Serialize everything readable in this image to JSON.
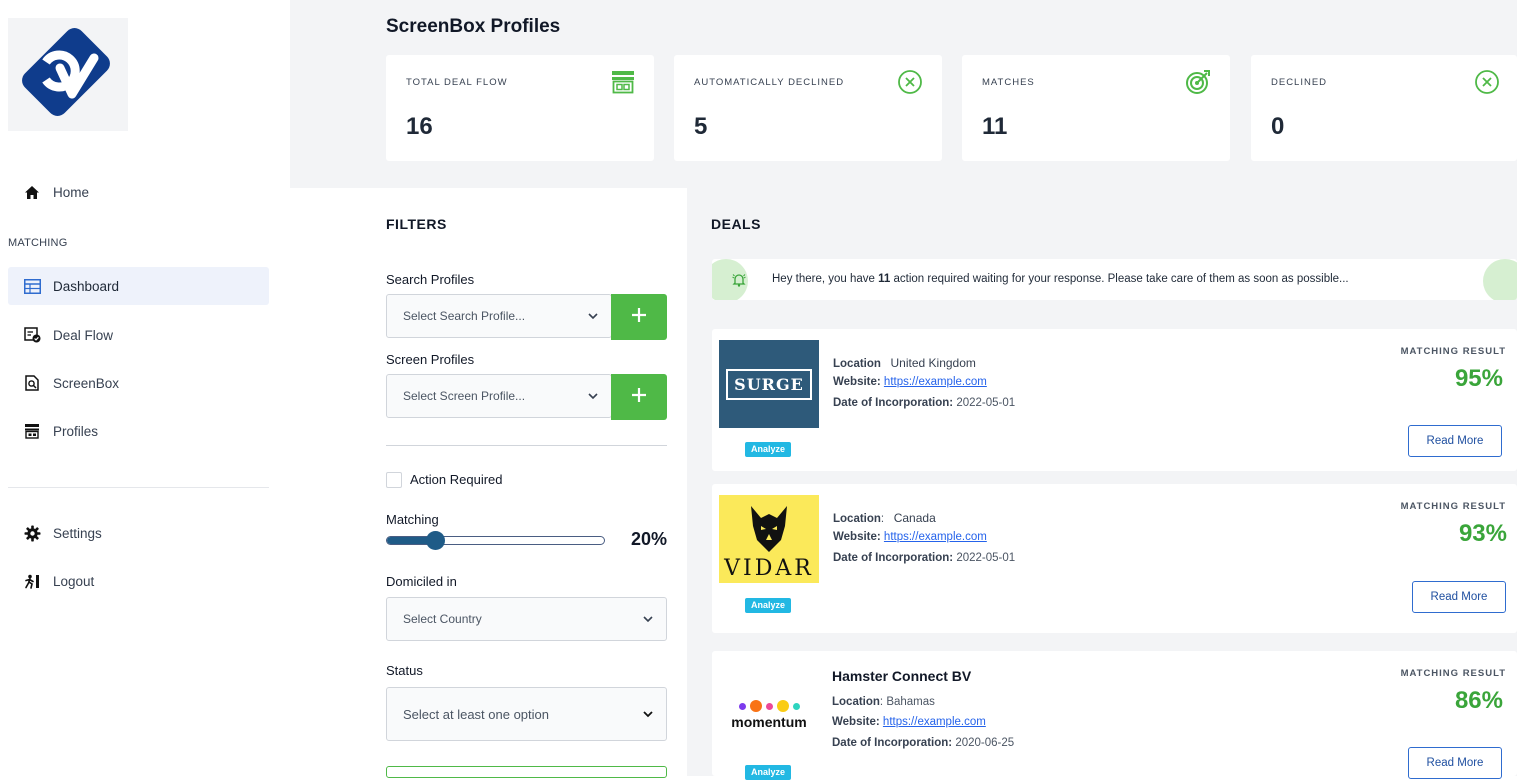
{
  "sidebar": {
    "logo_text": "cv",
    "home_label": "Home",
    "section_label": "MATCHING",
    "items": [
      {
        "label": "Dashboard"
      },
      {
        "label": "Deal Flow"
      },
      {
        "label": "ScreenBox"
      },
      {
        "label": "Profiles"
      }
    ],
    "settings_label": "Settings",
    "logout_label": "Logout"
  },
  "header": {
    "title": "ScreenBox Profiles"
  },
  "stats": [
    {
      "label": "TOTAL DEAL FLOW",
      "value": "16",
      "icon": "store-icon"
    },
    {
      "label": "AUTOMATICALLY DECLINED",
      "value": "5",
      "icon": "x-circle-icon"
    },
    {
      "label": "MATCHES",
      "value": "11",
      "icon": "target-icon"
    },
    {
      "label": "DECLINED",
      "value": "0",
      "icon": "x-circle-icon"
    }
  ],
  "filters": {
    "title": "FILTERS",
    "search_profiles_label": "Search Profiles",
    "search_profiles_placeholder": "Select Search Profile...",
    "screen_profiles_label": "Screen Profiles",
    "screen_profiles_placeholder": "Select Screen Profile...",
    "action_required_label": "Action Required",
    "matching_label": "Matching",
    "matching_value": "20%",
    "matching_fraction": 0.2,
    "domiciled_label": "Domiciled in",
    "domiciled_placeholder": "Select Country",
    "status_label": "Status",
    "status_placeholder": "Select at least one option"
  },
  "deals": {
    "title": "DEALS",
    "alert": {
      "prefix": "Hey there, you have ",
      "count": "11",
      "suffix": " action required waiting for your response. Please take care of them as soon as possible..."
    },
    "analyze_label": "Analyze",
    "matching_result_label": "MATCHING RESULT",
    "read_more_label": "Read More",
    "location_label": "Location",
    "website_label": "Website:",
    "doi_label": "Date of Incorporation:",
    "items": [
      {
        "logo_text": "SURGE",
        "location": "United Kingdom",
        "website": "https://example.com",
        "doi": "2022-05-01",
        "match": "95%"
      },
      {
        "logo_text": "VIDAR",
        "location": "Canada",
        "website": "https://example.com",
        "doi": "2022-05-01",
        "match": "93%"
      },
      {
        "name": "Hamster Connect BV",
        "logo_text": "momentum",
        "location": "Bahamas",
        "website": "https://example.com",
        "doi": "2020-06-25",
        "match": "86%"
      }
    ]
  },
  "colors": {
    "accent_green": "#4fb947",
    "match_green": "#3aa53a",
    "brand_navy": "#0f3c8c",
    "slider_blue": "#1f5b87",
    "analyze_cyan": "#22b8e3"
  }
}
